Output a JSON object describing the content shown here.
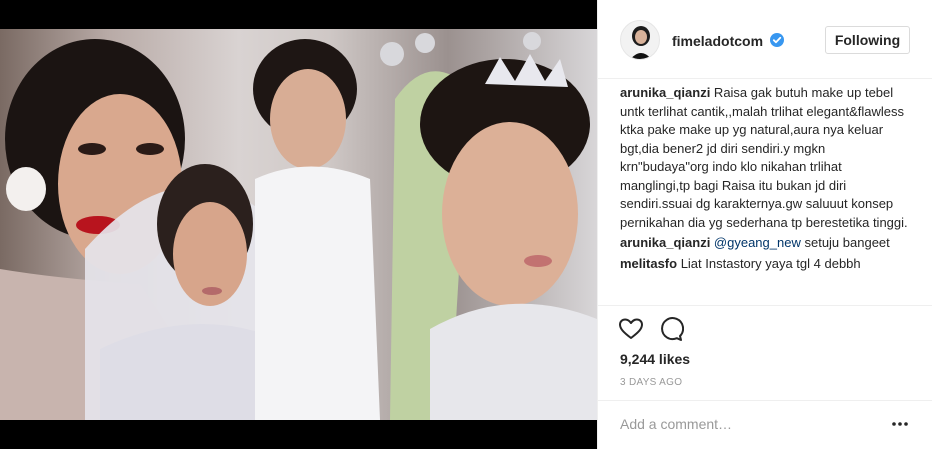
{
  "post": {
    "account": {
      "username": "fimeladotcom",
      "verified": true,
      "follow_label": "Following"
    },
    "comments": [
      {
        "user": "arunika_qianzi",
        "text": " Raisa gak butuh make up tebel untk terlihat cantik,,malah trlihat elegant&flawless ktka pake make up yg natural,aura nya keluar bgt,dia bener2 jd diri sendiri.y mgkn krn\"budaya\"org indo klo nikahan trlihat manglingi,tp bagi Raisa itu bukan jd diri sendiri.ssuai dg karakternya.gw saluuut konsep pernikahan dia yg sederhana tp berestetika tinggi."
      },
      {
        "user": "arunika_qianzi",
        "mention": " @gyeang_new",
        "text": " setuju bangeet"
      },
      {
        "user": "melitasfo",
        "text": " Liat Instastory yaya tgl 4 debbh"
      }
    ],
    "likes": "9,244 likes",
    "timestamp": "3 DAYS AGO",
    "add_comment_placeholder": "Add a comment…"
  },
  "icons": {
    "like": "heart-icon",
    "comment": "comment-icon",
    "verified": "verified-badge-icon",
    "options": "more-options-icon"
  },
  "colors": {
    "verified_blue": "#3897f0",
    "mention": "#003569",
    "muted": "#999999",
    "border": "#efefef"
  }
}
